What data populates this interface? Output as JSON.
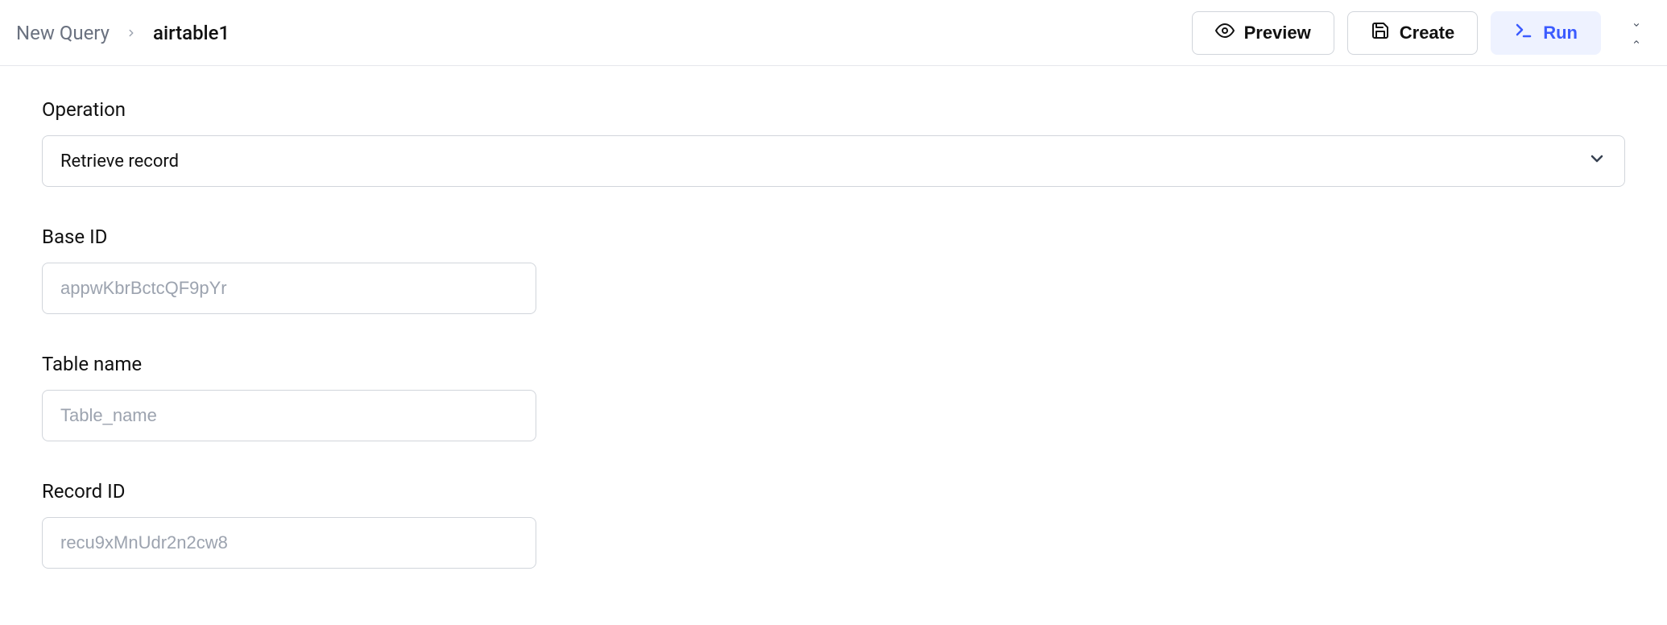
{
  "breadcrumb": {
    "root": "New Query",
    "current": "airtable1"
  },
  "actions": {
    "preview": "Preview",
    "create": "Create",
    "run": "Run"
  },
  "form": {
    "operation": {
      "label": "Operation",
      "selected": "Retrieve record"
    },
    "base_id": {
      "label": "Base ID",
      "placeholder": "appwKbrBctcQF9pYr",
      "value": ""
    },
    "table_name": {
      "label": "Table name",
      "placeholder": "Table_name",
      "value": ""
    },
    "record_id": {
      "label": "Record ID",
      "placeholder": "recu9xMnUdr2n2cw8",
      "value": ""
    }
  }
}
